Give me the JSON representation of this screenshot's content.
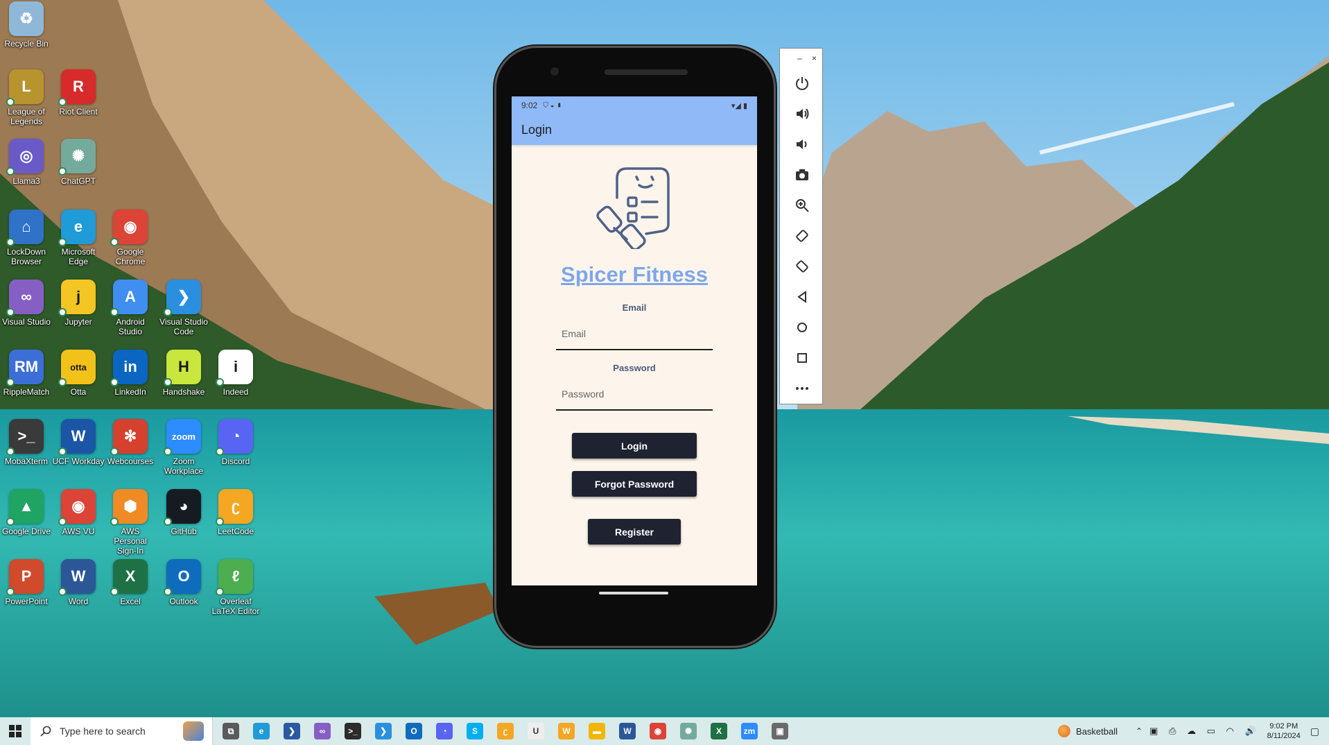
{
  "desktop": {
    "icons": [
      {
        "label": "Recycle Bin",
        "glyph": "♻",
        "color": "#8fb8d8"
      },
      {
        "label": "League of Legends",
        "glyph": "L",
        "color": "#b8942f"
      },
      {
        "label": "Riot Client",
        "glyph": "R",
        "color": "#d72a2a"
      },
      {
        "label": "Llama3",
        "glyph": "◎",
        "color": "#6a5ac8"
      },
      {
        "label": "ChatGPT",
        "glyph": "✺",
        "color": "#74aa9c"
      },
      {
        "label": "LockDown Browser",
        "glyph": "⌂",
        "color": "#2f72c8"
      },
      {
        "label": "Microsoft Edge",
        "glyph": "e",
        "color": "#1f9bd7"
      },
      {
        "label": "Google Chrome",
        "glyph": "◉",
        "color": "#db4437"
      },
      {
        "label": "Visual Studio",
        "glyph": "∞",
        "color": "#865fc5"
      },
      {
        "label": "Jupyter",
        "glyph": "j",
        "color": "#f3c623"
      },
      {
        "label": "Android Studio",
        "glyph": "A",
        "color": "#3f8ef0"
      },
      {
        "label": "Visual Studio Code",
        "glyph": "❯",
        "color": "#2b8fe0"
      },
      {
        "label": "RippleMatch",
        "glyph": "RM",
        "color": "#3c6ed8"
      },
      {
        "label": "Otta",
        "glyph": "otta",
        "color": "#f2c21b"
      },
      {
        "label": "LinkedIn",
        "glyph": "in",
        "color": "#0a66c2"
      },
      {
        "label": "Handshake",
        "glyph": "H",
        "color": "#c8e63c"
      },
      {
        "label": "Indeed",
        "glyph": "i",
        "color": "#ffffff"
      },
      {
        "label": "MobaXterm",
        "glyph": ">_",
        "color": "#3a3a3a"
      },
      {
        "label": "UCF Workday",
        "glyph": "W",
        "color": "#1b56a6"
      },
      {
        "label": "Webcourses",
        "glyph": "✻",
        "color": "#d6402f"
      },
      {
        "label": "Zoom Workplace",
        "glyph": "zoom",
        "color": "#2d8cff"
      },
      {
        "label": "Discord",
        "glyph": "◔",
        "color": "#5865f2"
      },
      {
        "label": "Google Drive",
        "glyph": "▲",
        "color": "#1fa463"
      },
      {
        "label": "AWS VU",
        "glyph": "◉",
        "color": "#db4437"
      },
      {
        "label": "AWS Personal Sign-In",
        "glyph": "⬢",
        "color": "#f08a24"
      },
      {
        "label": "GitHub",
        "glyph": "◕",
        "color": "#161b22"
      },
      {
        "label": "LeetCode",
        "glyph": "ʗ",
        "color": "#f5a623"
      },
      {
        "label": "PowerPoint",
        "glyph": "P",
        "color": "#d04a2b"
      },
      {
        "label": "Word",
        "glyph": "W",
        "color": "#2b5797"
      },
      {
        "label": "Excel",
        "glyph": "X",
        "color": "#1e7145"
      },
      {
        "label": "Outlook",
        "glyph": "O",
        "color": "#0f6cbd"
      },
      {
        "label": "Overleaf LaTeX Editor",
        "glyph": "ℓ",
        "color": "#4cae4f"
      }
    ]
  },
  "phone": {
    "status_time": "9:02",
    "appbar_title": "Login",
    "brand": "Spicer Fitness",
    "email_label": "Email",
    "email_placeholder": "Email",
    "password_label": "Password",
    "password_placeholder": "Password",
    "login_button": "Login",
    "forgot_button": "Forgot Password",
    "register_button": "Register",
    "accent_color": "#90b9f8",
    "background_color": "#fdf5ec"
  },
  "emulator_toolbar": {
    "minimize": "–",
    "close": "×",
    "buttons": [
      "power-icon",
      "volume-up-icon",
      "volume-down-icon",
      "camera-icon",
      "zoom-icon",
      "rotate-left-icon",
      "rotate-right-icon",
      "back-icon",
      "home-icon",
      "overview-icon",
      "more-icon"
    ]
  },
  "taskbar": {
    "search_placeholder": "Type here to search",
    "weather": "Basketball",
    "time": "9:02 PM",
    "date": "8/11/2024",
    "pinned": [
      {
        "name": "task-view-icon",
        "glyph": "⧉",
        "color": "#5a5a5a"
      },
      {
        "name": "edge-icon",
        "glyph": "e",
        "color": "#1f9bd7"
      },
      {
        "name": "powershell-icon",
        "glyph": "❯",
        "color": "#2c5aa0"
      },
      {
        "name": "visual-studio-icon",
        "glyph": "∞",
        "color": "#865fc5"
      },
      {
        "name": "terminal-icon",
        "glyph": ">_",
        "color": "#2b2b2b"
      },
      {
        "name": "vscode-icon",
        "glyph": "❯",
        "color": "#2b8fe0"
      },
      {
        "name": "outlook-icon",
        "glyph": "O",
        "color": "#0f6cbd"
      },
      {
        "name": "discord-icon",
        "glyph": "◔",
        "color": "#5865f2"
      },
      {
        "name": "skype-icon",
        "glyph": "S",
        "color": "#00aff0"
      },
      {
        "name": "leetcode-icon",
        "glyph": "ʗ",
        "color": "#f5a623"
      },
      {
        "name": "ucf-icon",
        "glyph": "U",
        "color": "#eeeeee"
      },
      {
        "name": "workday-icon",
        "glyph": "W",
        "color": "#f5a623"
      },
      {
        "name": "file-explorer-icon",
        "glyph": "▬",
        "color": "#f2b705"
      },
      {
        "name": "word-icon",
        "glyph": "W",
        "color": "#2b5797"
      },
      {
        "name": "chrome-icon",
        "glyph": "◉",
        "color": "#db4437"
      },
      {
        "name": "chatgpt-icon",
        "glyph": "✺",
        "color": "#74aa9c"
      },
      {
        "name": "excel-icon",
        "glyph": "X",
        "color": "#1e7145"
      },
      {
        "name": "zoom-icon",
        "glyph": "zm",
        "color": "#2d8cff"
      },
      {
        "name": "emulator-icon",
        "glyph": "▣",
        "color": "#6a6a6a"
      }
    ]
  }
}
